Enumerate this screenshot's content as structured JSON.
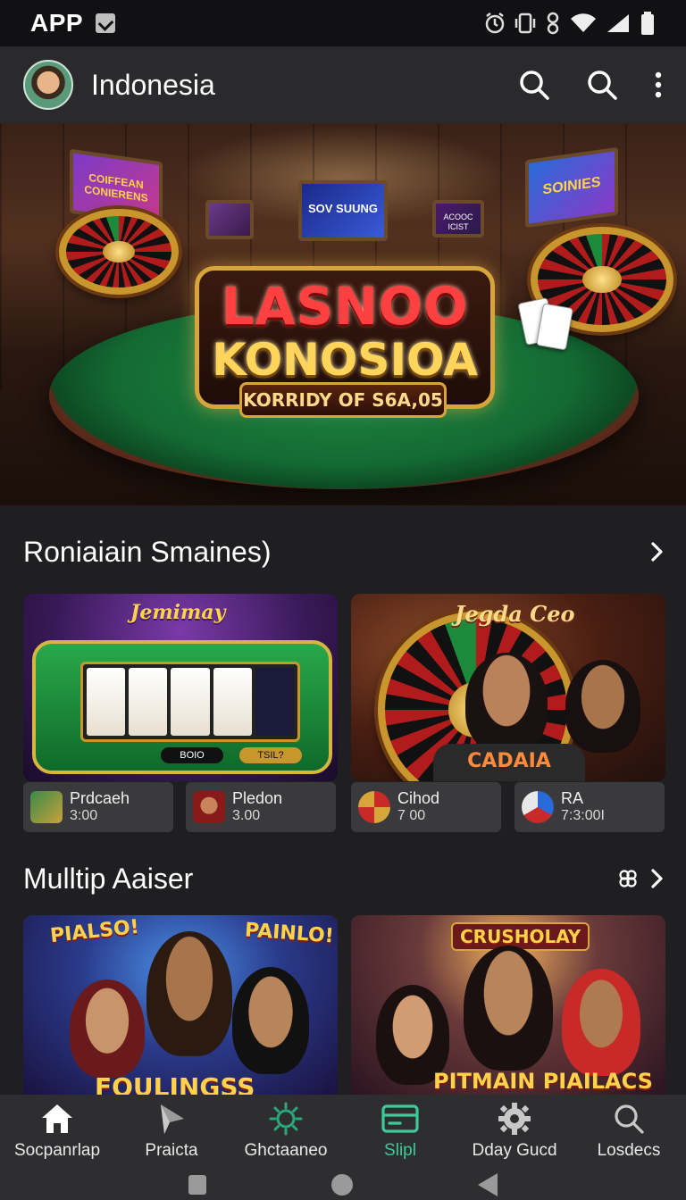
{
  "status_bar": {
    "app_label": "APP",
    "icons": [
      "check-icon",
      "alarm-icon",
      "vibrate-icon",
      "sync-icon",
      "wifi-icon",
      "signal-icon",
      "battery-icon"
    ]
  },
  "app_bar": {
    "title": "Indonesia",
    "actions": [
      "search-icon",
      "search-icon",
      "more-vert-icon"
    ]
  },
  "hero": {
    "title_line1": "LASNOO",
    "title_line2": "KONOSIOA",
    "ribbon": "KORRIDY OF S6A,05",
    "screen_labels": [
      "COIFFEAN CONIERENS",
      "SOV SUUNG",
      "SOINIES",
      "ACOOC ICIST"
    ]
  },
  "section1": {
    "title": "Roniaiain Smaines)",
    "cards": [
      {
        "banner": "Jemimay",
        "slot_buttons": [
          "BOIO",
          "TSIL?"
        ]
      },
      {
        "banner": "Jegda Ceo",
        "shirt_text": "CADAIA"
      }
    ],
    "chips": [
      {
        "name": "Prdcaeh",
        "time": "3:00"
      },
      {
        "name": "Pledon",
        "time": "3.00"
      },
      {
        "name": "Cihod",
        "time": "7 00"
      },
      {
        "name": "RA",
        "time": "7:3:00I"
      }
    ]
  },
  "section2": {
    "title": "Mulltip Aaiser",
    "cards": [
      {
        "banner_left": "PIALSO!",
        "banner_right": "PAINLO!",
        "bottom_text": "FOULINGSS"
      },
      {
        "banner": "CRUSHOLAY",
        "bottom_text": "PITMAIN PIAILACS"
      }
    ]
  },
  "bottom_nav": {
    "items": [
      {
        "label": "Socpanrlap",
        "icon": "home-icon"
      },
      {
        "label": "Praicta",
        "icon": "play-icon"
      },
      {
        "label": "Ghctaaneo",
        "icon": "sun-icon"
      },
      {
        "label": "Slipl",
        "icon": "wallet-icon",
        "active": true
      },
      {
        "label": "Dday Gucd",
        "icon": "gear-icon"
      },
      {
        "label": "Losdecs",
        "icon": "search-icon"
      }
    ]
  },
  "colors": {
    "background": "#1f1f22",
    "app_bar": "#2a2a2d",
    "accent_active": "#3ec99a",
    "chip_bg": "#3a3a3d"
  }
}
